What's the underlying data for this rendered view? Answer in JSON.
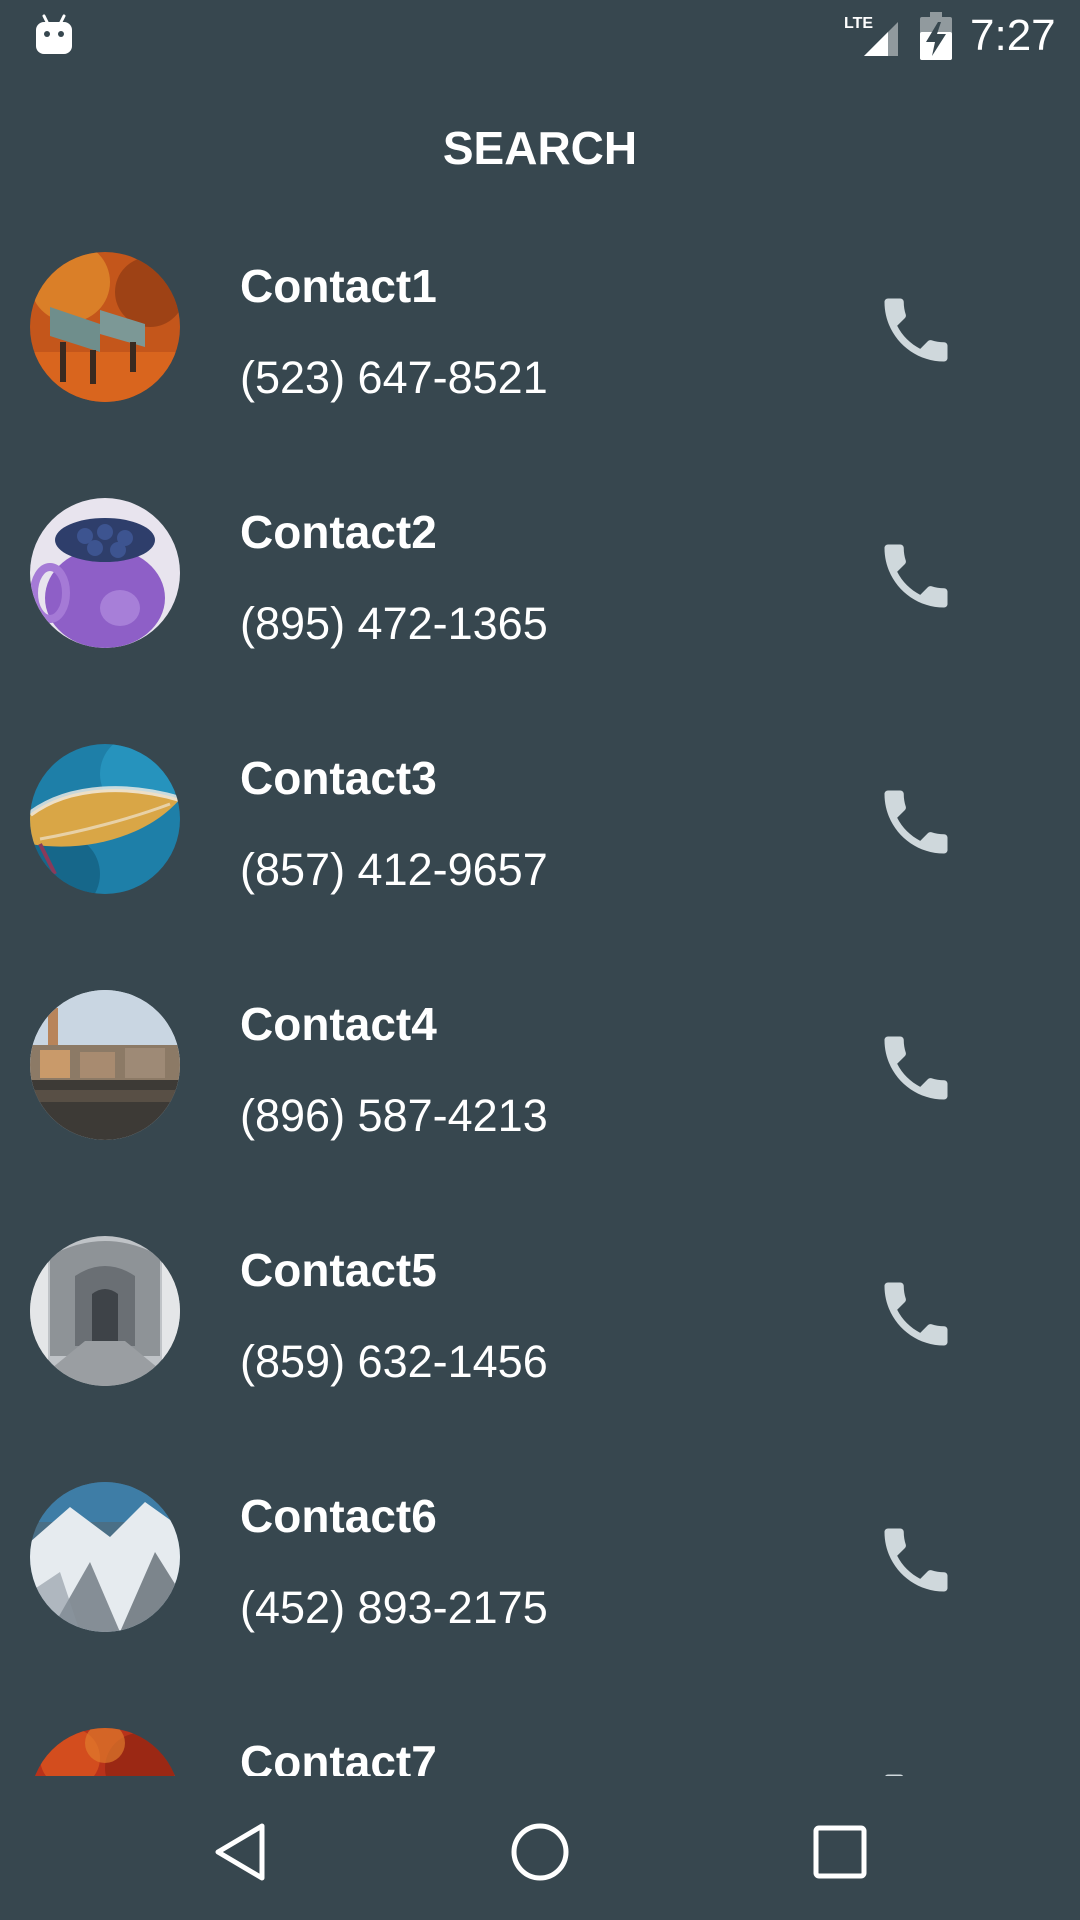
{
  "status_bar": {
    "network_label": "LTE",
    "time": "7:27",
    "icons": [
      "android-icon",
      "lte-signal-icon",
      "battery-charging-icon"
    ]
  },
  "header": {
    "title": "SEARCH"
  },
  "contacts": [
    {
      "name": "Contact1",
      "phone": "(523) 647-8521",
      "avatar": "autumn-bench-photo"
    },
    {
      "name": "Contact2",
      "phone": "(895) 472-1365",
      "avatar": "blueberries-cup-photo"
    },
    {
      "name": "Contact3",
      "phone": "(857) 412-9657",
      "avatar": "frosted-leaf-photo"
    },
    {
      "name": "Contact4",
      "phone": "(896) 587-4213",
      "avatar": "riverside-town-photo"
    },
    {
      "name": "Contact5",
      "phone": "(859) 632-1456",
      "avatar": "cloister-arches-photo"
    },
    {
      "name": "Contact6",
      "phone": "(452) 893-2175",
      "avatar": "snowy-mountains-photo"
    },
    {
      "name": "Contact7",
      "phone": "",
      "avatar": "red-foliage-photo"
    }
  ],
  "call_icon": "phone-icon",
  "nav_bar": {
    "icons": [
      "back-icon",
      "home-icon",
      "recents-icon"
    ]
  },
  "colors": {
    "background": "#37474F",
    "text": "#FFFFFF",
    "call_icon": "#CFD8DC"
  }
}
